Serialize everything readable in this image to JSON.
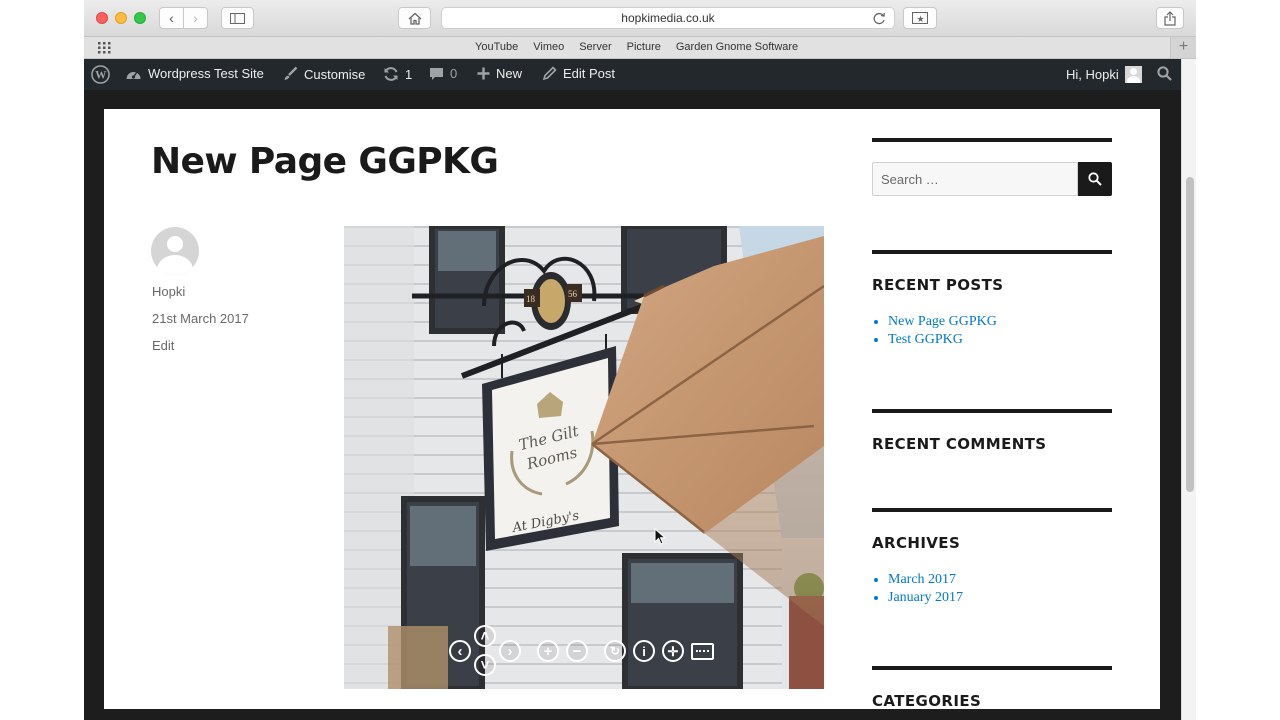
{
  "browser": {
    "url": "hopkimedia.co.uk",
    "favorites": [
      "YouTube",
      "Vimeo",
      "Server",
      "Picture",
      "Garden Gnome Software"
    ]
  },
  "admin_bar": {
    "site_name": "Wordpress Test Site",
    "customise": "Customise",
    "updates_count": "1",
    "comments_count": "0",
    "new": "New",
    "edit_post": "Edit Post",
    "greeting": "Hi, Hopki"
  },
  "post": {
    "title": "New Page GGPKG",
    "author": "Hopki",
    "date": "21st March 2017",
    "edit": "Edit",
    "sign": {
      "line1": "The Gilt",
      "line2": "Rooms",
      "line3": "At Digby's",
      "year_left": "18",
      "year_right": "56"
    }
  },
  "sidebar": {
    "search_placeholder": "Search …",
    "recent_posts_title": "RECENT POSTS",
    "recent_posts": [
      "New Page GGPKG",
      "Test GGPKG"
    ],
    "recent_comments_title": "RECENT COMMENTS",
    "archives_title": "ARCHIVES",
    "archives": [
      "March 2017",
      "January 2017"
    ],
    "categories_title": "CATEGORIES"
  },
  "colors": {
    "accent_link": "#007acc",
    "admin_bar": "#23282d"
  }
}
